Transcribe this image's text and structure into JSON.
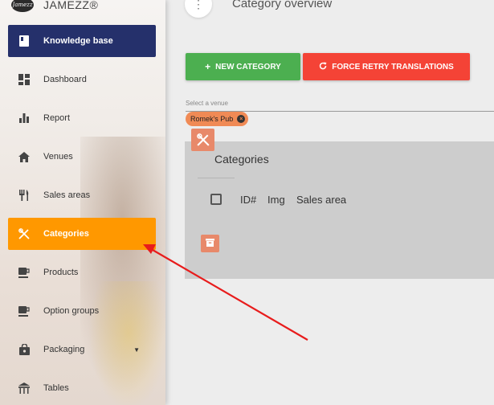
{
  "app": {
    "logo_mark": "Jamezz",
    "brand": "JAMEZZ®"
  },
  "sidebar": {
    "items": [
      {
        "label": "Knowledge base",
        "icon": "book-icon"
      },
      {
        "label": "Dashboard",
        "icon": "dashboard-icon"
      },
      {
        "label": "Report",
        "icon": "bar-chart-icon"
      },
      {
        "label": "Venues",
        "icon": "home-icon"
      },
      {
        "label": "Sales areas",
        "icon": "cutlery-icon"
      },
      {
        "label": "Categories",
        "icon": "cross-cutlery-icon"
      },
      {
        "label": "Products",
        "icon": "cup-icon"
      },
      {
        "label": "Option groups",
        "icon": "cup-icon"
      },
      {
        "label": "Packaging",
        "icon": "bag-icon"
      },
      {
        "label": "Tables",
        "icon": "table-icon"
      }
    ]
  },
  "header": {
    "title": "Category overview",
    "menu_glyph": "⋮"
  },
  "toolbar": {
    "new_category": "NEW CATEGORY",
    "force_retry": "FORCE RETRY TRANSLATIONS",
    "new_color": "#4caf50",
    "retry_color": "#f44336"
  },
  "venue_select": {
    "label": "Select a venue",
    "chip": "Romek's Pub",
    "chip_remove": "×"
  },
  "categories_panel": {
    "title": "Categories",
    "columns": [
      "ID#",
      "Img",
      "Sales area"
    ]
  },
  "colors": {
    "kb_active": "#25306b",
    "categories_active": "#ff9800",
    "accent_orange": "#e8896a"
  }
}
